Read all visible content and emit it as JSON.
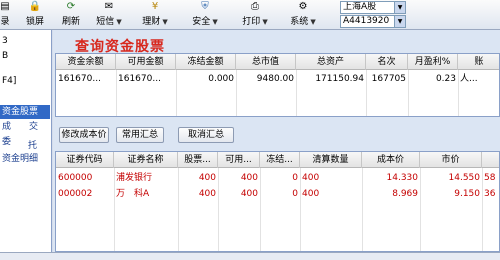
{
  "toolbar": {
    "items": [
      {
        "label": "录",
        "icon": "record-icon"
      },
      {
        "label": "锁屏",
        "icon": "lock-icon"
      },
      {
        "label": "刷新",
        "icon": "refresh-icon"
      },
      {
        "label": "短信",
        "icon": "message-icon"
      },
      {
        "label": "理财",
        "icon": "finance-icon"
      },
      {
        "label": "安全",
        "icon": "security-icon"
      },
      {
        "label": "打印",
        "icon": "print-icon"
      },
      {
        "label": "系统",
        "icon": "system-icon"
      }
    ],
    "market_select": "上海A股",
    "account_select": "A4413920"
  },
  "sidebar": {
    "items": [
      "3",
      "B",
      "",
      "F4]",
      "资金股票",
      "成　　交",
      "委",
      "托",
      "资金明细"
    ]
  },
  "main": {
    "title": "查询资金股票",
    "funds_table": {
      "headers": [
        "资金余额",
        "可用金额",
        "冻结金额",
        "总市值",
        "总资产",
        "名次",
        "月盈利%",
        "账"
      ],
      "row": [
        "161670...",
        "161670...",
        "0.000",
        "9480.00",
        "171150.94",
        "167705",
        "0.23",
        "人..."
      ]
    },
    "buttons": {
      "edit_cost": "修改成本价",
      "summary": "常用汇总",
      "cancel_summary": "取消汇总"
    },
    "stock_table": {
      "headers": [
        "证券代码",
        "证券名称",
        "股票...",
        "可用...",
        "冻结...",
        "清算数量",
        "成本价",
        "市价"
      ],
      "rows": [
        [
          "600000",
          "浦发银行",
          "400",
          "400",
          "0",
          "400",
          "14.330",
          "14.550",
          "58"
        ],
        [
          "000002",
          "万　科A",
          "400",
          "400",
          "0",
          "400",
          "8.969",
          "9.150",
          "36"
        ]
      ]
    }
  }
}
